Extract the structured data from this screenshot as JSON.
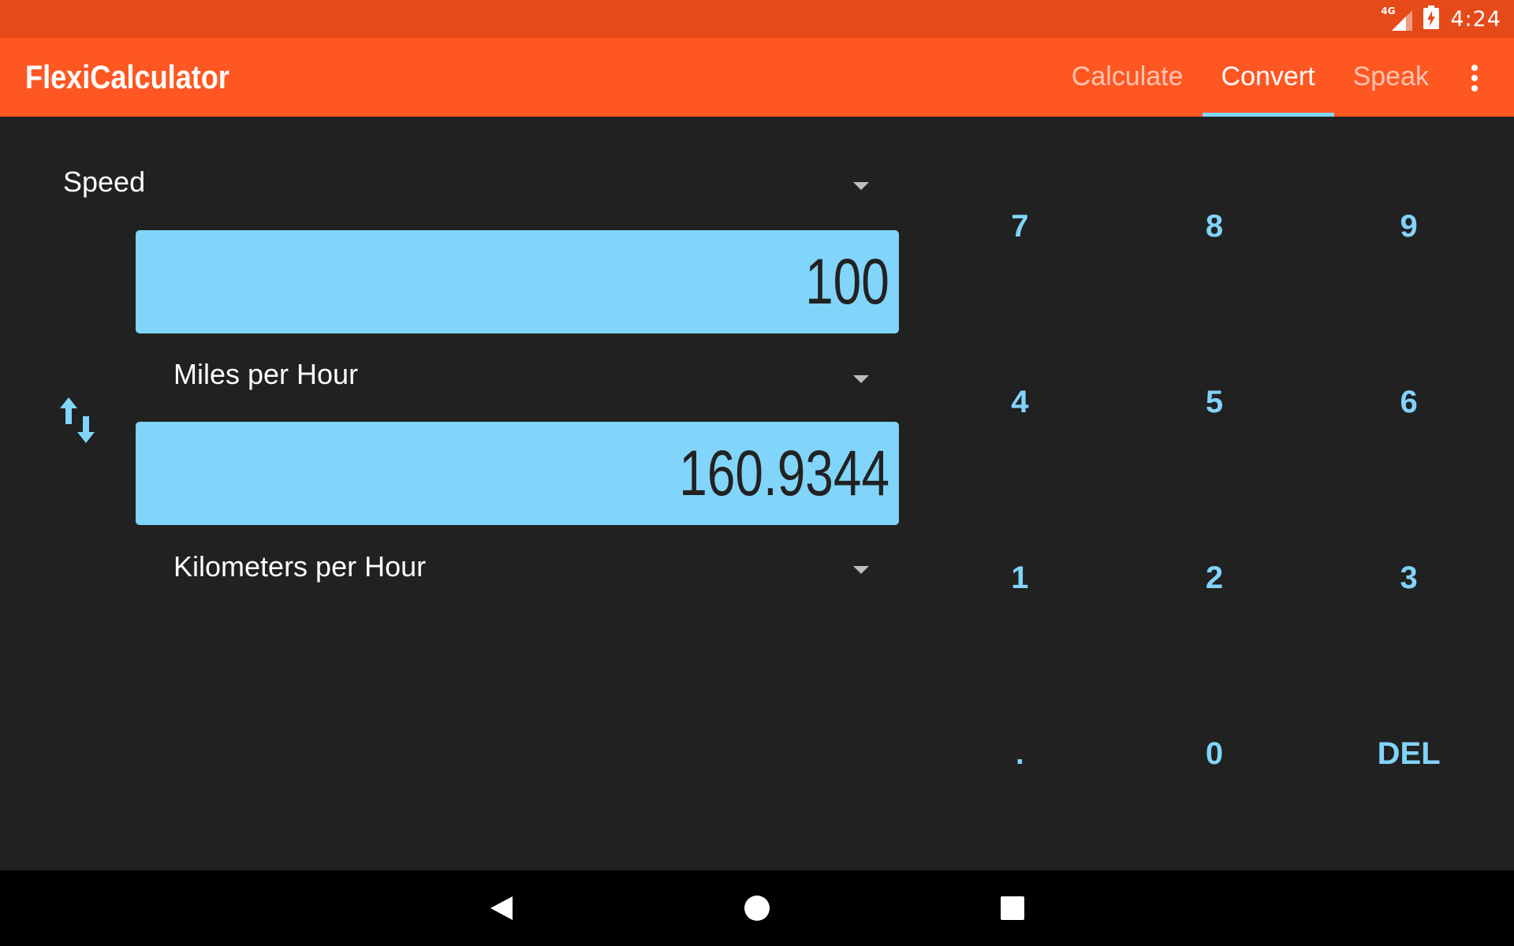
{
  "status_bar": {
    "network_label": "4G",
    "time": "4:24",
    "icons": [
      "signal-icon",
      "battery-charging-icon"
    ]
  },
  "app_bar": {
    "title": "FlexiCalculator",
    "tabs": [
      {
        "label": "Calculate",
        "active": false
      },
      {
        "label": "Convert",
        "active": true
      },
      {
        "label": "Speak",
        "active": false
      }
    ],
    "overflow_icon": "more-vert-icon"
  },
  "converter": {
    "category": "Speed",
    "input_value": "100",
    "input_unit": "Miles per Hour",
    "output_value": "160.9344",
    "output_unit": "Kilometers per Hour",
    "swap_icon": "swap-vertical-icon"
  },
  "keypad": {
    "keys": [
      "7",
      "8",
      "9",
      "4",
      "5",
      "6",
      "1",
      "2",
      "3",
      ".",
      "0",
      "DEL"
    ]
  },
  "nav_bar": {
    "icons": [
      "back-icon",
      "home-icon",
      "recents-icon"
    ]
  },
  "colors": {
    "status_bar": "#E64A19",
    "app_bar": "#FF5722",
    "accent": "#81D4FA",
    "background": "#212121",
    "nav_bar": "#000000"
  }
}
